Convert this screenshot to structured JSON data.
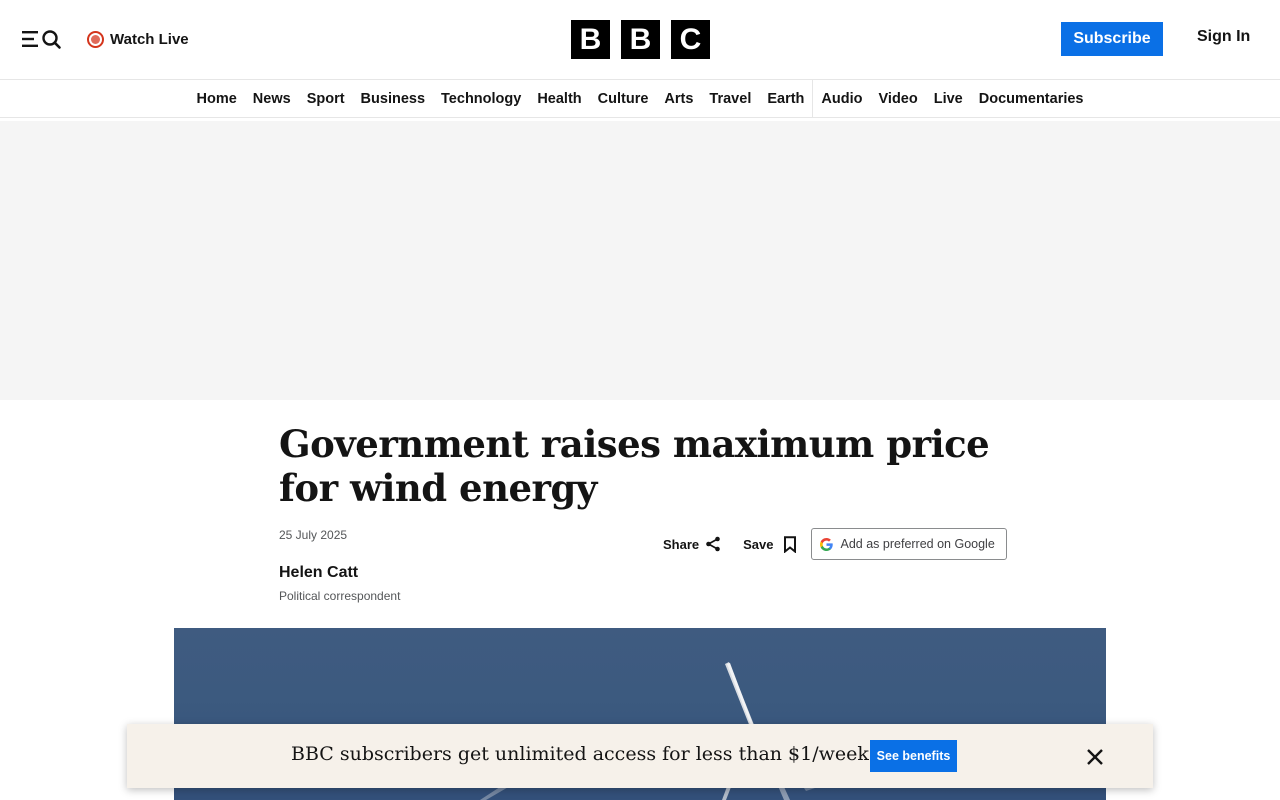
{
  "header": {
    "watch_live": "Watch Live",
    "logo_letters": [
      "B",
      "B",
      "C"
    ],
    "subscribe": "Subscribe",
    "sign_in": "Sign In"
  },
  "nav": {
    "items": [
      "Home",
      "News",
      "Sport",
      "Business",
      "Technology",
      "Health",
      "Culture",
      "Arts",
      "Travel",
      "Earth",
      "Audio",
      "Video",
      "Live",
      "Documentaries"
    ]
  },
  "article": {
    "headline": "Government raises maximum price for wind energy",
    "date": "25 July 2025",
    "author": "Helen Catt",
    "author_role": "Political correspondent",
    "share": "Share",
    "save": "Save",
    "google_preferred": "Add as preferred on Google"
  },
  "banner": {
    "text": "BBC subscribers get unlimited access for less than $1/week",
    "button": "See benefits"
  },
  "icons": {
    "menu": "menu-icon",
    "search": "search-icon",
    "live": "live-dot-icon",
    "share": "share-icon",
    "save": "bookmark-icon",
    "google": "google-g-icon",
    "close": "close-icon"
  },
  "colors": {
    "brand_blue": "#0a70e6",
    "live_red": "#d4351c",
    "ad_background": "#f5f5f5",
    "banner_background": "#f6f1ea",
    "hero_sky": "#3f5b80"
  }
}
